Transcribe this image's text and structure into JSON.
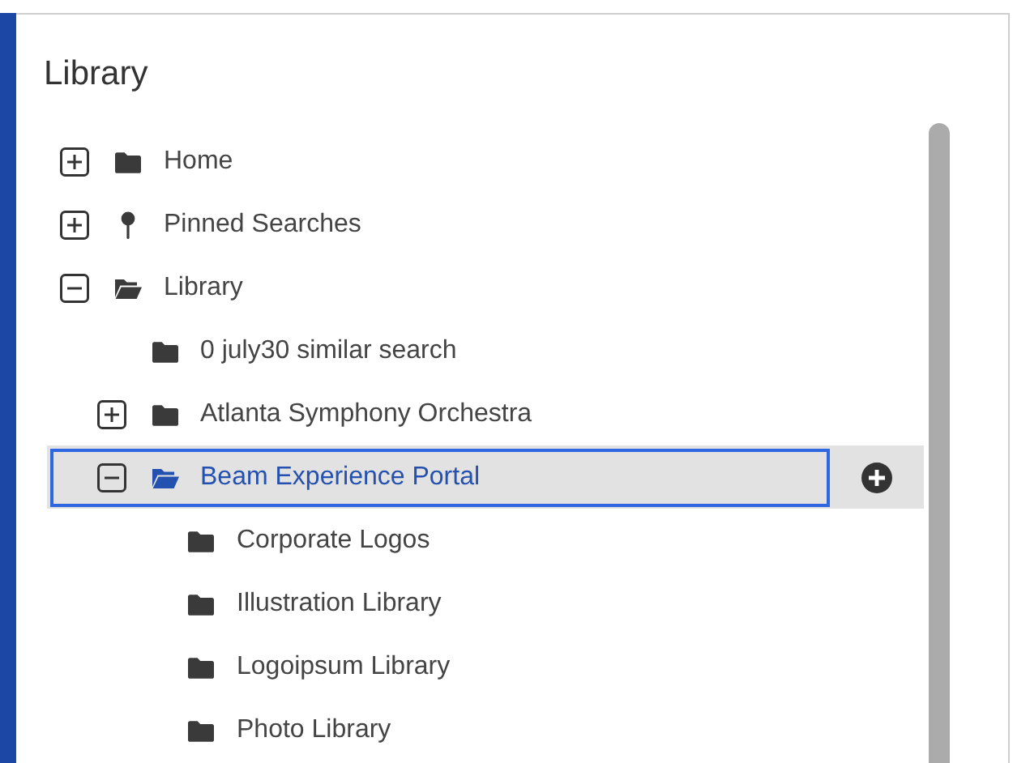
{
  "panel": {
    "title": "Library"
  },
  "tree": [
    {
      "label": "Home",
      "kind": "folder",
      "expanded": false,
      "selected": false
    },
    {
      "label": "Pinned Searches",
      "kind": "pin",
      "expanded": false,
      "selected": false
    },
    {
      "label": "Library",
      "kind": "folder",
      "expanded": true,
      "selected": false,
      "children": [
        {
          "label": "0 july30 similar search",
          "kind": "folder",
          "selected": false
        },
        {
          "label": "Atlanta Symphony Orchestra",
          "kind": "folder",
          "expanded": false,
          "selected": false
        },
        {
          "label": "Beam Experience Portal",
          "kind": "folder",
          "expanded": true,
          "selected": true,
          "children": [
            {
              "label": "Corporate Logos",
              "kind": "folder",
              "selected": false
            },
            {
              "label": "Illustration Library",
              "kind": "folder",
              "selected": false
            },
            {
              "label": "Logoipsum Library",
              "kind": "folder",
              "selected": false
            },
            {
              "label": "Photo Library",
              "kind": "folder",
              "selected": false
            }
          ]
        }
      ]
    }
  ]
}
